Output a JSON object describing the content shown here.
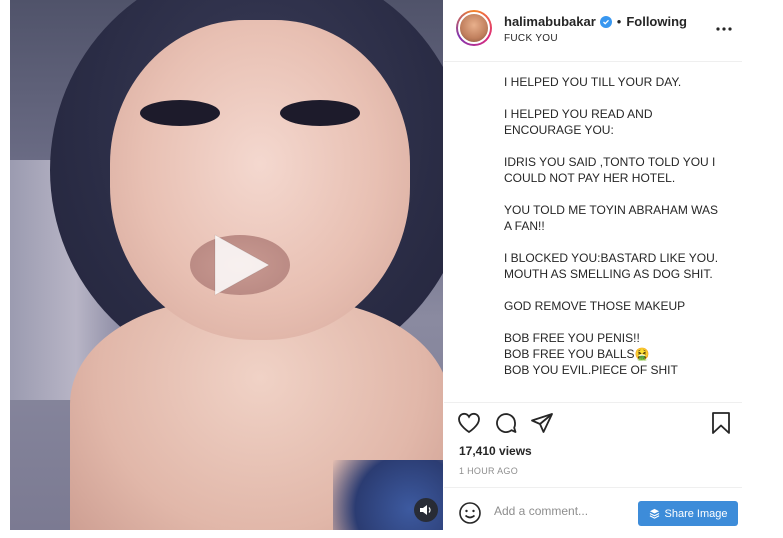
{
  "post": {
    "username": "halimabubakar",
    "follow_status": "Following",
    "separator": "•",
    "location": "FUCK YOU",
    "caption_lines": [
      [
        "I HELPED YOU TILL YOUR DAY."
      ],
      [
        "I HELPED YOU READ AND",
        "ENCOURAGE YOU:"
      ],
      [
        "IDRIS YOU SAID ,TONTO TOLD YOU I",
        "COULD NOT PAY HER HOTEL."
      ],
      [
        "YOU TOLD ME TOYIN ABRAHAM WAS",
        "A FAN!!"
      ],
      [
        "I BLOCKED YOU:BASTARD LIKE YOU.",
        "MOUTH AS SMELLING AS DOG SHIT."
      ],
      [
        "GOD REMOVE THOSE MAKEUP"
      ],
      [
        "BOB FREE YOU PENIS!!",
        "BOB FREE YOU BALLS🤮",
        "BOB YOU EVIL.PIECE OF SHIT"
      ]
    ],
    "likes": "17,410 views",
    "timestamp": "1 HOUR AGO"
  },
  "comment": {
    "placeholder": "Add a comment..."
  },
  "share_button": {
    "label": "Share Image"
  },
  "icons": {
    "verified": "verified-badge-icon",
    "more": "more-options-icon",
    "like": "heart-icon",
    "comment": "comment-icon",
    "share": "send-icon",
    "save": "bookmark-icon",
    "emoji": "emoji-icon",
    "play": "play-icon",
    "mute": "speaker-icon"
  },
  "colors": {
    "accent": "#3d8cd9",
    "verified": "#3897f0",
    "muted": "#8e8e8e"
  }
}
